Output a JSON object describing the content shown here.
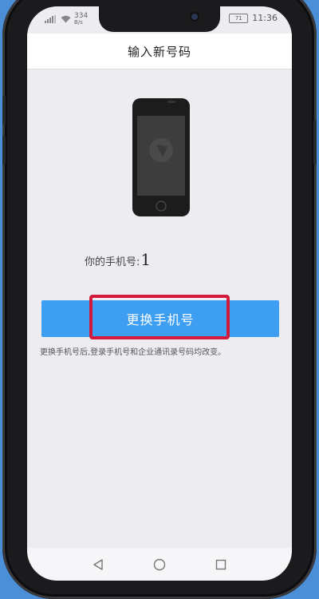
{
  "status_bar": {
    "signal_text": "334",
    "signal_sub": "B/s",
    "battery": "71",
    "time": "11:36"
  },
  "header": {
    "title": "输入新号码"
  },
  "main": {
    "phone_label": "你的手机号:",
    "phone_number": "1",
    "change_button_label": "更换手机号",
    "hint_text": "更换手机号后,登录手机号和企业通讯录号码均改变。"
  },
  "navbar": {
    "back": "back-triangle-icon",
    "home": "home-circle-icon",
    "recent": "recent-square-icon"
  },
  "colors": {
    "primary_button": "#3e9ef2",
    "highlight_border": "#d41a3a",
    "screen_background": "#ededf1",
    "wallpaper": "#4a8fd8"
  }
}
